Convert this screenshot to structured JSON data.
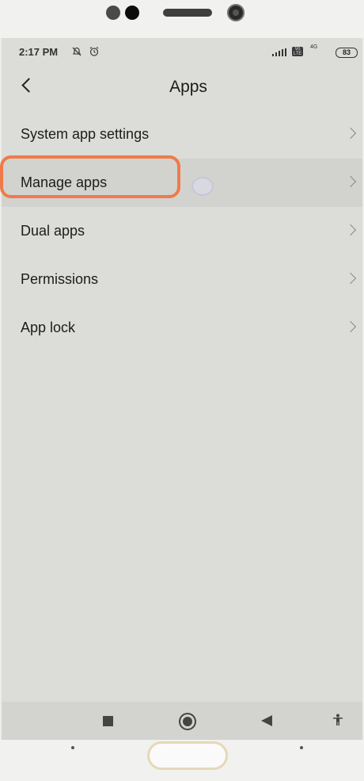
{
  "statusbar": {
    "time": "2:17 PM",
    "mute_icon": "bell-off-icon",
    "alarm_icon": "alarm-icon",
    "volte": "Vo LTE",
    "network": "4G",
    "battery": "83"
  },
  "appbar": {
    "title": "Apps",
    "back_icon": "back-arrow-icon"
  },
  "menu": {
    "items": [
      {
        "label": "System app settings"
      },
      {
        "label": "Manage apps"
      },
      {
        "label": "Dual apps"
      },
      {
        "label": "Permissions"
      },
      {
        "label": "App lock"
      }
    ],
    "highlighted_index": 1
  },
  "navbar": {
    "recents_icon": "square-recents-icon",
    "home_icon": "circle-home-icon",
    "back_icon": "triangle-back-icon",
    "accessibility_icon": "accessibility-icon"
  },
  "colors": {
    "highlight": "#f07a4a",
    "screen_bg": "#dcddd8"
  }
}
